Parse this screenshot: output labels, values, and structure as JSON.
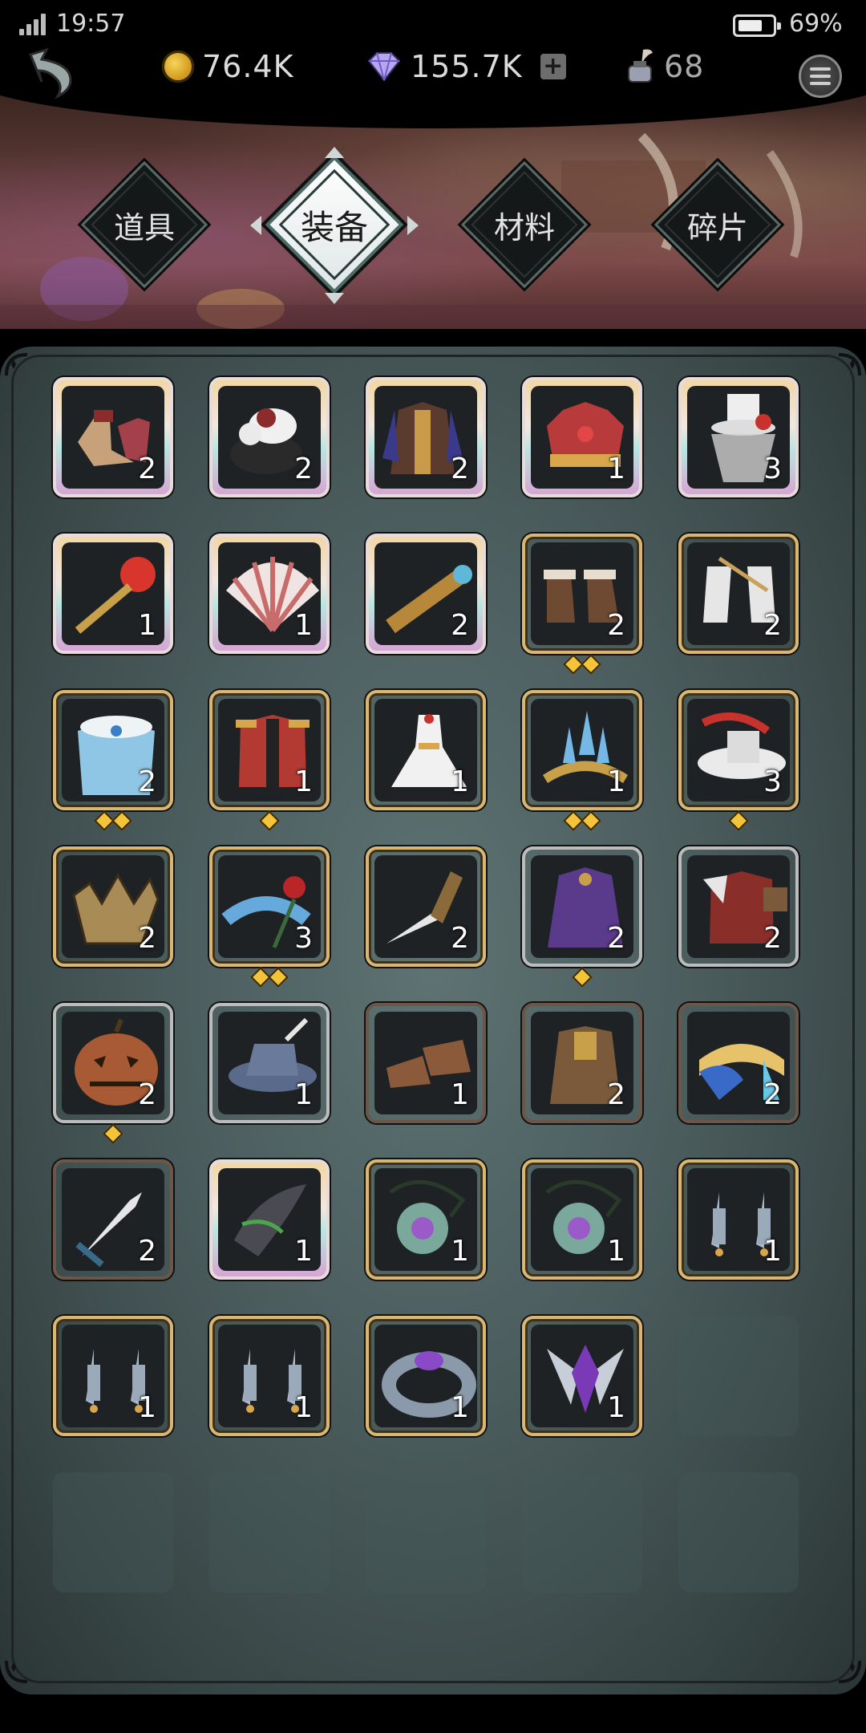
{
  "status": {
    "time": "19:57",
    "battery": "69%"
  },
  "currency": {
    "gold": "76.4K",
    "gems": "155.7K",
    "ink": "68"
  },
  "tabs": [
    {
      "label": "道具",
      "active": false
    },
    {
      "label": "装备",
      "active": true
    },
    {
      "label": "材料",
      "active": false
    },
    {
      "label": "碎片",
      "active": false
    }
  ],
  "colors": {
    "gold_frame": "#d9b773",
    "silver_frame": "#bcbcbc",
    "bronze_frame": "#6b5647",
    "star": "#f3c33a"
  },
  "items": [
    {
      "icon": "boots-icon",
      "count": "2",
      "frame": "rainbow",
      "stars": 0
    },
    {
      "icon": "fur-collar-icon",
      "count": "2",
      "frame": "rainbow",
      "stars": 0
    },
    {
      "icon": "vest-icon",
      "count": "2",
      "frame": "rainbow",
      "stars": 0
    },
    {
      "icon": "crown-icon",
      "count": "1",
      "frame": "rainbow",
      "stars": 0
    },
    {
      "icon": "top-hat-icon",
      "count": "3",
      "frame": "rainbow",
      "stars": 0
    },
    {
      "icon": "orb-scepter-icon",
      "count": "1",
      "frame": "rainbow",
      "stars": 0
    },
    {
      "icon": "folding-fan-icon",
      "count": "1",
      "frame": "rainbow",
      "stars": 0
    },
    {
      "icon": "spyglass-icon",
      "count": "2",
      "frame": "rainbow",
      "stars": 0
    },
    {
      "icon": "fur-boots-icon",
      "count": "2",
      "frame": "gold",
      "stars": 2
    },
    {
      "icon": "white-boots-icon",
      "count": "2",
      "frame": "gold",
      "stars": 0
    },
    {
      "icon": "snow-cape-icon",
      "count": "2",
      "frame": "gold",
      "stars": 2
    },
    {
      "icon": "military-coat-icon",
      "count": "1",
      "frame": "gold",
      "stars": 1
    },
    {
      "icon": "white-dress-icon",
      "count": "1",
      "frame": "gold",
      "stars": 0
    },
    {
      "icon": "crystal-tiara-icon",
      "count": "1",
      "frame": "gold",
      "stars": 2
    },
    {
      "icon": "feather-hat-icon",
      "count": "3",
      "frame": "gold",
      "stars": 1
    },
    {
      "icon": "broken-crown-icon",
      "count": "2",
      "frame": "gold",
      "stars": 0
    },
    {
      "icon": "rose-icon",
      "count": "3",
      "frame": "gold",
      "stars": 2
    },
    {
      "icon": "dagger-icon",
      "count": "2",
      "frame": "gold",
      "stars": 0
    },
    {
      "icon": "purple-cloak-icon",
      "count": "2",
      "frame": "silver",
      "stars": 1
    },
    {
      "icon": "red-coat-icon",
      "count": "2",
      "frame": "silver",
      "stars": 0
    },
    {
      "icon": "pumpkin-icon",
      "count": "2",
      "frame": "silver",
      "stars": 1
    },
    {
      "icon": "blue-hat-icon",
      "count": "1",
      "frame": "silver",
      "stars": 0
    },
    {
      "icon": "leather-shoes-icon",
      "count": "1",
      "frame": "bronze",
      "stars": 0
    },
    {
      "icon": "tunic-icon",
      "count": "2",
      "frame": "bronze",
      "stars": 0
    },
    {
      "icon": "scarf-icon",
      "count": "2",
      "frame": "bronze",
      "stars": 0
    },
    {
      "icon": "short-sword-icon",
      "count": "2",
      "frame": "bronze",
      "stars": 0
    },
    {
      "icon": "horn-icon",
      "count": "1",
      "frame": "rainbow",
      "stars": 0
    },
    {
      "icon": "amulet-icon",
      "count": "1",
      "frame": "gold",
      "stars": 0
    },
    {
      "icon": "amulet-icon",
      "count": "1",
      "frame": "gold",
      "stars": 0
    },
    {
      "icon": "earrings-icon",
      "count": "1",
      "frame": "gold",
      "stars": 0
    },
    {
      "icon": "earrings-icon",
      "count": "1",
      "frame": "gold",
      "stars": 0
    },
    {
      "icon": "earrings-icon",
      "count": "1",
      "frame": "gold",
      "stars": 0
    },
    {
      "icon": "bracelet-icon",
      "count": "1",
      "frame": "gold",
      "stars": 0
    },
    {
      "icon": "winged-gem-icon",
      "count": "1",
      "frame": "gold",
      "stars": 0
    }
  ]
}
